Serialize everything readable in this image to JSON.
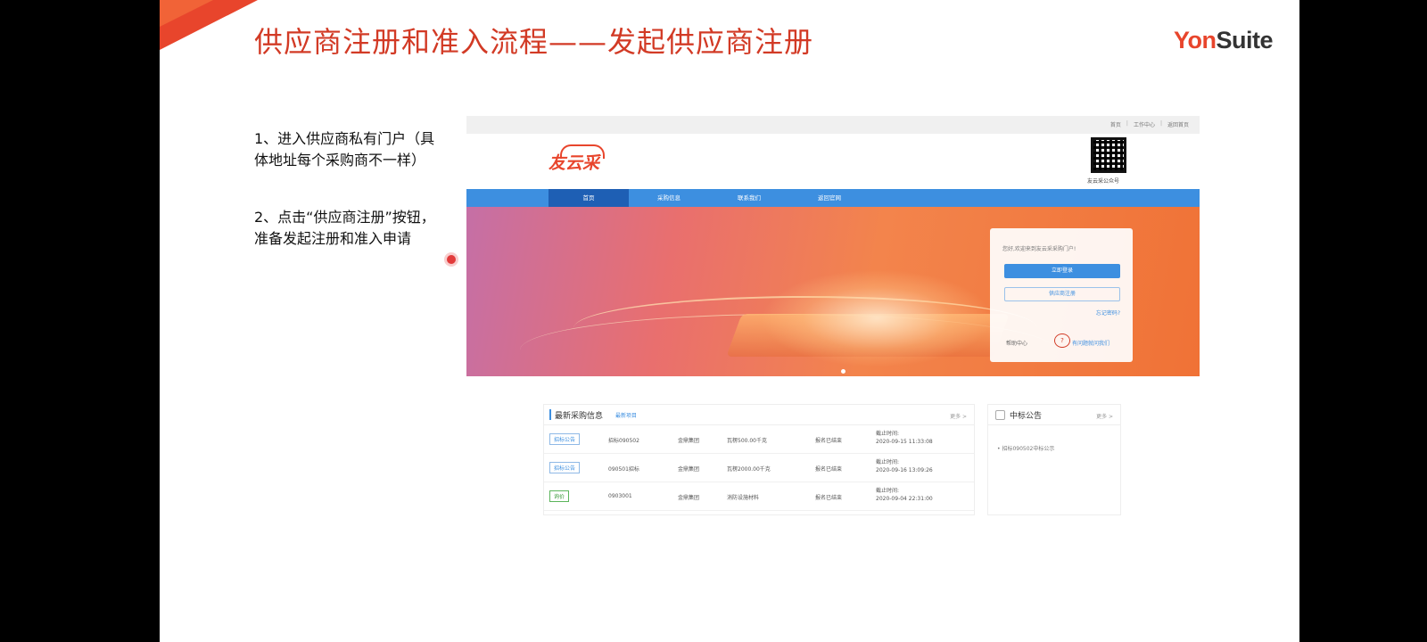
{
  "slide": {
    "title": "供应商注册和准入流程——发起供应商注册",
    "brand_y": "Yon",
    "brand_s": "Suite",
    "step1": "1、进入供应商私有门户（具体地址每个采购商不一样）",
    "step2": "2、点击“供应商注册”按钮，准备发起注册和准入申请"
  },
  "portal": {
    "toplinks": [
      "首页",
      "工作中心",
      "返回首页"
    ],
    "logo": "友云采",
    "qr_label": "友云采公众号",
    "nav": [
      "首页",
      "采购信息",
      "联系我们",
      "返回官网"
    ],
    "login": {
      "welcome": "您好,欢迎来到友云采采购门户!",
      "login_button": "立即登录",
      "register_button": "供应商注册",
      "forgot": "忘记密码?",
      "help": "帮助中心",
      "help_icon": "?",
      "ask": "有问题就问我们"
    },
    "procurement": {
      "title": "最新采购信息",
      "tab": "最新项目",
      "more": "更多 >",
      "rows": [
        {
          "tag": "招标公告",
          "code": "招标090502",
          "org": "金鼎集团",
          "item": "瓦楞500.00千克",
          "status": "报名已结束",
          "deadline_label": "截止时间:",
          "deadline": "2020-09-15 11:33:08"
        },
        {
          "tag": "招标公告",
          "code": "090501招标",
          "org": "金鼎集团",
          "item": "瓦楞2000.00千克",
          "status": "报名已结束",
          "deadline_label": "截止时间:",
          "deadline": "2020-09-16 13:09:26"
        },
        {
          "tag": "询价",
          "code": "0903001",
          "org": "金鼎集团",
          "item": "消防设施材料",
          "status": "报名已结束",
          "deadline_label": "截止时间:",
          "deadline": "2020-09-04 22:31:00"
        }
      ]
    },
    "award": {
      "title": "中标公告",
      "more": "更多 >",
      "item": "• 招标090502中标公示"
    }
  },
  "colors": {
    "accent_red": "#d23a25",
    "nav_blue": "#3d8fe0"
  }
}
